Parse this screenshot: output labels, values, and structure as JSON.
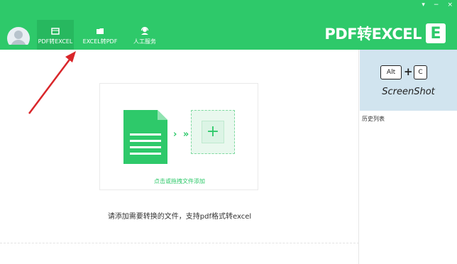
{
  "window_controls": {
    "minimize": "▾",
    "restore": "−",
    "close": "×"
  },
  "nav": {
    "tabs": [
      {
        "label": "PDF转EXCEL",
        "icon": "pdf-to-excel-icon"
      },
      {
        "label": "EXCEL转PDF",
        "icon": "excel-to-pdf-icon"
      },
      {
        "label": "人工服务",
        "icon": "headset-icon"
      }
    ]
  },
  "brand": {
    "title": "PDF转EXCEL",
    "logo_letter": "E"
  },
  "dropzone": {
    "label": "点击或拖拽文件添加",
    "arrows": "› »",
    "plus": "+"
  },
  "hint": "请添加需要转换的文件，支持pdf格式转excel",
  "side": {
    "key_alt": "Alt",
    "key_plus": "+",
    "key_c": "C",
    "screenshot_label": "ScreenShot",
    "history_label": "历史列表"
  },
  "colors": {
    "brand_green": "#2ec96a",
    "active_tab": "#27b85f",
    "annotation_arrow": "#d9262a"
  }
}
